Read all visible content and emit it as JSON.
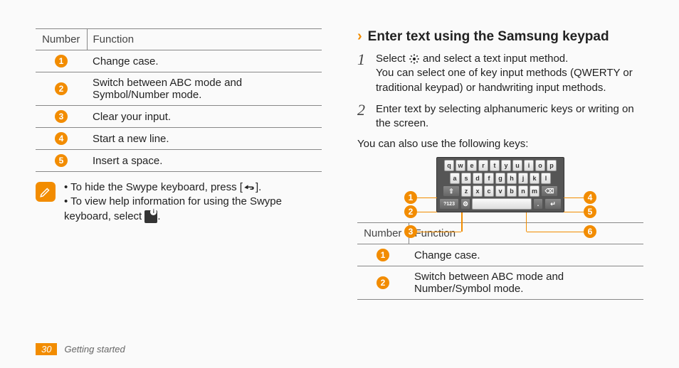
{
  "left_table": {
    "headers": [
      "Number",
      "Function"
    ],
    "rows": [
      {
        "n": "1",
        "fn": "Change case."
      },
      {
        "n": "2",
        "fn": "Switch between ABC mode and Symbol/Number mode."
      },
      {
        "n": "3",
        "fn": "Clear your input."
      },
      {
        "n": "4",
        "fn": "Start a new line."
      },
      {
        "n": "5",
        "fn": "Insert a space."
      }
    ]
  },
  "note": {
    "item1_pre": "To hide the Swype keyboard, press [",
    "item1_post": "].",
    "item2_pre": "To view help information for using the Swype keyboard, select ",
    "item2_post": "."
  },
  "right": {
    "heading": "Enter text using the Samsung keypad",
    "step1_num": "1",
    "step1a_pre": "Select ",
    "step1a_post": " and select a text input method.",
    "step1b": "You can select one of key input methods (QWERTY or traditional keypad) or handwriting input methods.",
    "step2_num": "2",
    "step2": "Enter text by selecting alphanumeric keys or writing on the screen.",
    "para": "You can also use the following keys:"
  },
  "keyboard": {
    "row1": [
      "q",
      "w",
      "e",
      "r",
      "t",
      "y",
      "u",
      "i",
      "o",
      "p"
    ],
    "row2": [
      "a",
      "s",
      "d",
      "f",
      "g",
      "h",
      "j",
      "k",
      "l"
    ],
    "row3_shift": "⇧",
    "row3": [
      "z",
      "x",
      "c",
      "v",
      "b",
      "n",
      "m"
    ],
    "row3_del": "⌫",
    "row4_mode": "?123",
    "row4_gear": "⚙",
    "row4_period": ".",
    "row4_enter": "↵"
  },
  "callouts": {
    "c1": "1",
    "c2": "2",
    "c3": "3",
    "c4": "4",
    "c5": "5",
    "c6": "6"
  },
  "right_table": {
    "headers": [
      "Number",
      "Function"
    ],
    "rows": [
      {
        "n": "1",
        "fn": "Change case."
      },
      {
        "n": "2",
        "fn": "Switch between ABC mode and Number/Symbol mode."
      }
    ]
  },
  "footer": {
    "page": "30",
    "section": "Getting started"
  }
}
